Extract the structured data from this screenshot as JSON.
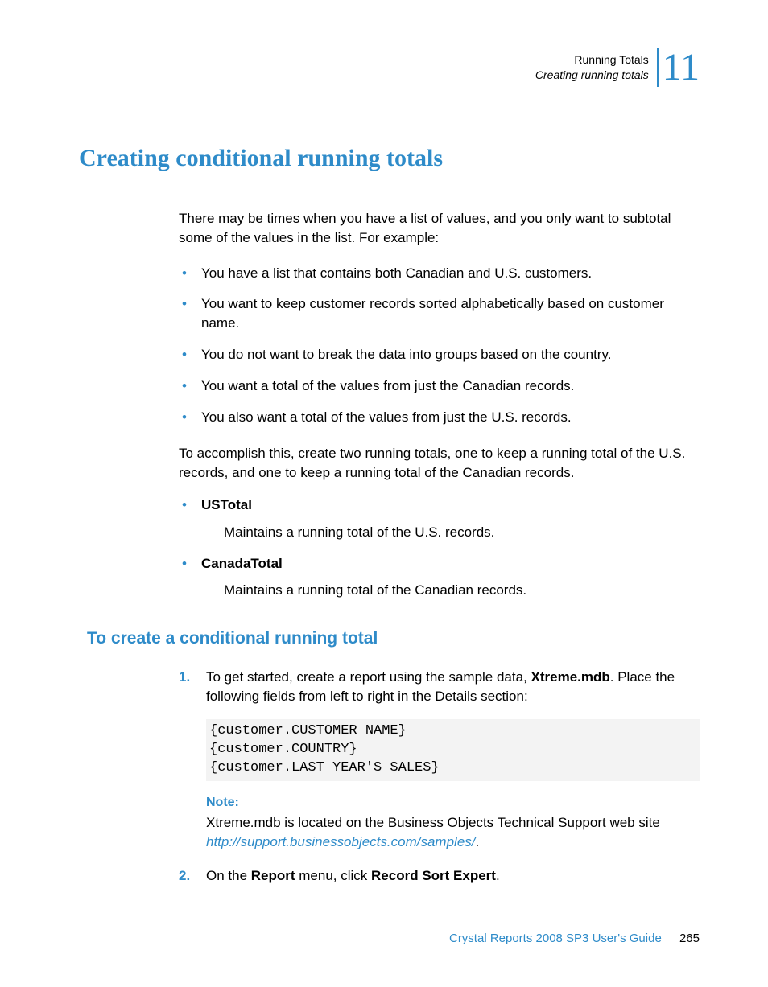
{
  "header": {
    "title": "Running Totals",
    "subtitle": "Creating running totals",
    "chapter": "11"
  },
  "h1": "Creating conditional running totals",
  "intro": "There may be times when you have a list of values, and you only want to subtotal some of the values in the list. For example:",
  "bullets1": [
    "You have a list that contains both Canadian and U.S. customers.",
    "You want to keep customer records sorted alphabetically based on customer name.",
    "You do not want to break the data into groups based on the country.",
    "You want a total of the values from just the Canadian records.",
    "You also want a total of the values from just the U.S. records."
  ],
  "transition": "To accomplish this, create two running totals, one to keep a running total of the U.S. records, and one to keep a running total of the Canadian records.",
  "defs": [
    {
      "name": "USTotal",
      "desc": "Maintains a running total of the U.S. records."
    },
    {
      "name": "CanadaTotal",
      "desc": "Maintains a running total of the Canadian records."
    }
  ],
  "h2": "To create a conditional running total",
  "steps": {
    "s1_pre": "To get started, create a report using the sample data, ",
    "s1_bold": "Xtreme.mdb",
    "s1_post": ". Place the following fields from left to right in the Details section:",
    "code": "{customer.CUSTOMER NAME}\n{customer.COUNTRY}\n{customer.LAST YEAR'S SALES}",
    "note_label": "Note:",
    "note_pre": "Xtreme.mdb is located on the Business Objects Technical Support web site ",
    "note_link": "http://support.businessobjects.com/samples/",
    "note_post": ".",
    "s2_pre": "On the ",
    "s2_b1": "Report",
    "s2_mid": " menu, click ",
    "s2_b2": "Record Sort Expert",
    "s2_post": "."
  },
  "footer": {
    "title": "Crystal Reports 2008 SP3 User's Guide",
    "page": "265"
  }
}
